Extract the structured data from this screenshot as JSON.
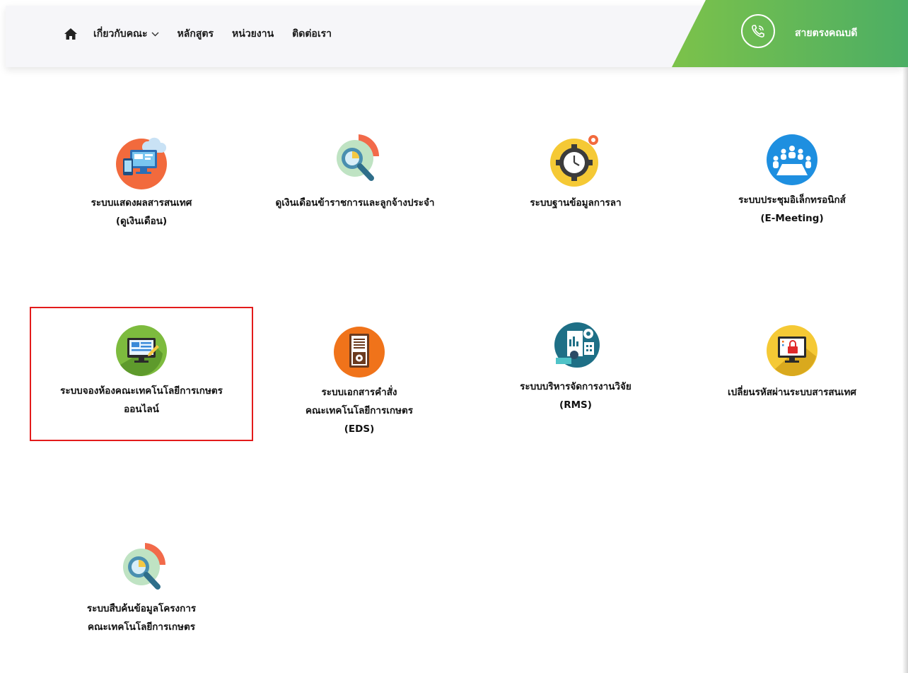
{
  "nav": {
    "items": [
      {
        "label": "เกี่ยวกับคณะ",
        "dropdown": true
      },
      {
        "label": "หลักสูตร",
        "dropdown": false
      },
      {
        "label": "หน่วยงาน",
        "dropdown": false
      },
      {
        "label": "ติดต่อเรา",
        "dropdown": false
      }
    ],
    "hotline_label": "สายตรงคณบดี"
  },
  "colors": {
    "hotline_start": "#7cc24a",
    "hotline_end": "#4cae64",
    "highlight": "#e31b1b"
  },
  "tiles": [
    {
      "icon": "computer-screens-icon",
      "lines": [
        "ระบบแสดงผลสารสนเทศ",
        "(ดูเงินเดือน)"
      ]
    },
    {
      "icon": "magnifier-chart-icon",
      "lines": [
        "ดูเงินเดือนข้าราชการและลูกจ้างประจำ"
      ]
    },
    {
      "icon": "gear-clock-icon",
      "lines": [
        "ระบบฐานข้อมูลการลา"
      ]
    },
    {
      "icon": "meeting-people-icon",
      "lines": [
        "ระบบประชุมอิเล็กทรอนิกส์",
        "(E-Meeting)"
      ]
    },
    {
      "icon": "monitor-pencil-icon",
      "lines": [
        "ระบบจองห้องคณะเทคโนโลยีการเกษตร",
        "ออนไลน์"
      ]
    },
    {
      "icon": "document-gear-icon",
      "lines": [
        "ระบบเอกสารคำสั่ง",
        "คณะเทคโนโลยีการเกษตร",
        "(EDS)"
      ]
    },
    {
      "icon": "research-analytics-icon",
      "lines": [
        "ระบบบริหารจัดการงานวิจัย",
        "(RMS)"
      ]
    },
    {
      "icon": "monitor-lock-icon",
      "lines": [
        "เปลี่ยนรหัสผ่านระบบสารสนเทศ"
      ]
    },
    {
      "icon": "magnifier-chart-icon",
      "lines": [
        "ระบบสืบค้นข้อมูลโครงการ",
        "คณะเทคโนโลยีการเกษตร"
      ]
    }
  ]
}
